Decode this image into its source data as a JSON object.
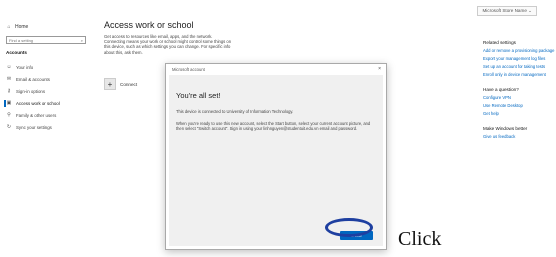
{
  "titlebar": {
    "account_button": "Microsoft Store Name  ⌄"
  },
  "sidebar": {
    "home": "Home",
    "search_placeholder": "Find a setting",
    "section_title": "Accounts",
    "items": [
      {
        "label": "Your info",
        "icon": "person-icon"
      },
      {
        "label": "Email & accounts",
        "icon": "mail-icon"
      },
      {
        "label": "Sign-in options",
        "icon": "key-icon"
      },
      {
        "label": "Access work or school",
        "icon": "briefcase-icon"
      },
      {
        "label": "Family & other users",
        "icon": "people-icon"
      },
      {
        "label": "Sync your settings",
        "icon": "sync-icon"
      }
    ]
  },
  "main": {
    "title": "Access work or school",
    "description": "Get access to resources like email, apps, and the network. Connecting means your work or school might control some things on this device, such as which settings you can change. For specific info about this, ask them.",
    "connect_label": "Connect"
  },
  "right": {
    "related_heading": "Related settings",
    "related_links": [
      "Add or remove a provisioning package",
      "Export your management log files",
      "Set up an account for taking tests",
      "Enroll only in device management"
    ],
    "question_heading": "Have a question?",
    "question_links": [
      "Configure VPN",
      "Use Remote Desktop",
      "Get help"
    ],
    "better_heading": "Make Windows better",
    "better_links": [
      "Give us feedback"
    ]
  },
  "dialog": {
    "title": "Microsoft account",
    "close": "×",
    "heading": "You're all set!",
    "line1": "This device is connected to University of Information Technology.",
    "line2": "When you're ready to use this new account, select the Start button, select your current account picture, and then select \"Switch account\". Sign in using your linhnguyen@studentuit.edu.vn email and password.",
    "done": "Done"
  },
  "annotation": {
    "click": "Click"
  }
}
